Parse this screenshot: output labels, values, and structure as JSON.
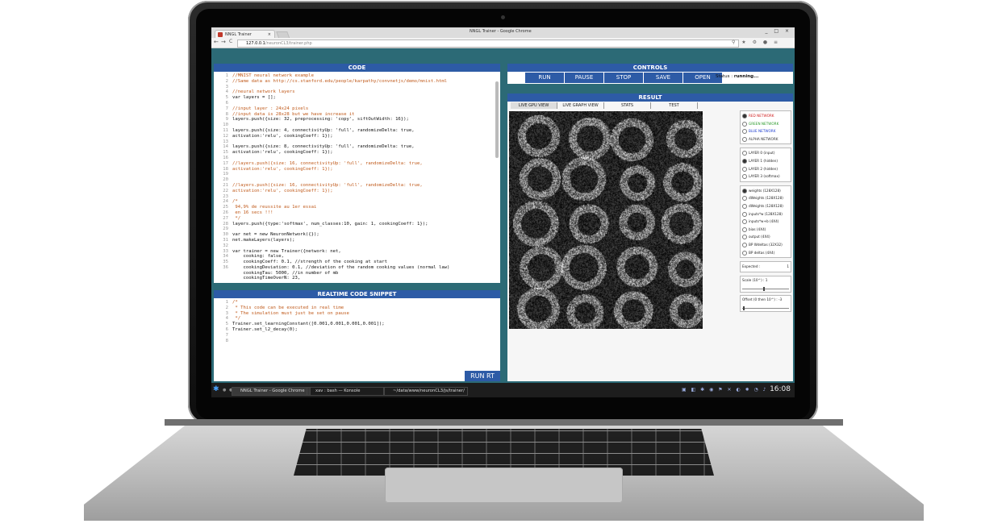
{
  "window": {
    "title": "NNGL Trainer - Google Chrome",
    "tab_title": "NNGL Trainer",
    "tab_close": "×",
    "buttons": "_ □ ×"
  },
  "browser": {
    "url_host": "127.0.0.1",
    "url_path": "/neuronCL3/trainer.php",
    "back": "←",
    "forward": "→",
    "reload": "C"
  },
  "code_panel": {
    "title": "CODE",
    "line_numbers": "1\n2\n3\n4\n5\n6\n7\n8\n9\n10\n11\n12\n13\n14\n15\n16\n17\n18\n19\n20\n21\n22\n23\n24\n25\n26\n27\n28\n29\n30\n31\n32\n33\n34\n35\n36",
    "lines": [
      {
        "t": "//MNIST neural network example",
        "c": "c-com"
      },
      {
        "t": "//Same data as http://cs.stanford.edu/people/karpathy/convnetjs/demo/mnist.html",
        "c": "c-com"
      },
      {
        "t": "",
        "c": ""
      },
      {
        "t": "//neural network layers",
        "c": "c-com"
      },
      {
        "t": "var layers = [];",
        "c": ""
      },
      {
        "t": "",
        "c": ""
      },
      {
        "t": "//input layer : 24x24 pixels",
        "c": "c-com"
      },
      {
        "t": "//input data is 28x28 but we have increase it",
        "c": "c-com"
      },
      {
        "t": "layers.push({size: 32, preprocessing: 'copy', siftOutWidth: 16});",
        "c": ""
      },
      {
        "t": "",
        "c": ""
      },
      {
        "t": "layers.push({size: 4, connectivityUp: 'full', randomizeDelta: true,",
        "c": ""
      },
      {
        "t": "activation:'relu', cookingCoeff: 1});",
        "c": ""
      },
      {
        "t": "",
        "c": ""
      },
      {
        "t": "layers.push({size: 8, connectivityUp: 'full', randomizeDelta: true,",
        "c": ""
      },
      {
        "t": "activation:'relu', cookingCoeff: 1});",
        "c": ""
      },
      {
        "t": "",
        "c": ""
      },
      {
        "t": "//layers.push({size: 16, connectivityUp: 'full', randomizeDelta: true,",
        "c": "c-com"
      },
      {
        "t": "activation:'relu', cookingCoeff: 1});",
        "c": "c-com"
      },
      {
        "t": "",
        "c": ""
      },
      {
        "t": "",
        "c": ""
      },
      {
        "t": "//layers.push({size: 16, connectivityUp: 'full', randomizeDelta: true,",
        "c": "c-com"
      },
      {
        "t": "activation:'relu', cookingCoeff: 1});",
        "c": "c-com"
      },
      {
        "t": "",
        "c": ""
      },
      {
        "t": "/*",
        "c": "c-com"
      },
      {
        "t": " 94,9% de reussite au 1er essai",
        "c": "c-com"
      },
      {
        "t": " en 16 secs !!!",
        "c": "c-com"
      },
      {
        "t": " */",
        "c": "c-com"
      },
      {
        "t": "layers.push({type:'softmax', num_classes:10, gain: 1, cookingCoeff: 1});",
        "c": ""
      },
      {
        "t": "",
        "c": ""
      },
      {
        "t": "var net = new NeuronNetwork({});",
        "c": ""
      },
      {
        "t": "net.makeLayers(layers);",
        "c": ""
      },
      {
        "t": "",
        "c": ""
      },
      {
        "t": "var trainer = new Trainer({network: net,",
        "c": ""
      },
      {
        "t": "    cooking: false,",
        "c": ""
      },
      {
        "t": "    cookingCoeff: 0.1, //strength of the cooking at start",
        "c": ""
      },
      {
        "t": "    cookingDeviation: 0.1, //deviation of the random cooking values (normal law)",
        "c": ""
      },
      {
        "t": "    cookingTau: 5000, //in number of mb",
        "c": ""
      },
      {
        "t": "    cookingTimeOverN: 23,",
        "c": ""
      }
    ]
  },
  "snippet_panel": {
    "title": "REALTIME CODE SNIPPET",
    "line_numbers": "1\n2\n3\n4\n5\n6\n7\n8",
    "lines": [
      {
        "t": "/*",
        "c": "c-com"
      },
      {
        "t": " * This code can be executed in real time",
        "c": "c-com"
      },
      {
        "t": " * The simulation must just be set on pause",
        "c": "c-com"
      },
      {
        "t": " */",
        "c": "c-com"
      },
      {
        "t": "Trainer.set_learningConstant([0.001,0.001,0.001,0.001]);",
        "c": ""
      },
      {
        "t": "Trainer.set_l2_decay(0);",
        "c": ""
      },
      {
        "t": "",
        "c": ""
      },
      {
        "t": "",
        "c": ""
      }
    ],
    "run_label": "RUN RT"
  },
  "controls": {
    "title": "CONTROLS",
    "buttons": [
      "RUN",
      "PAUSE",
      "STOP",
      "SAVE",
      "OPEN"
    ],
    "status_label": "Status :",
    "status_value": "running..."
  },
  "result": {
    "title": "RESULT",
    "tabs": [
      "LIVE GPU VIEW",
      "LIVE GRAPH VIEW",
      "STATS",
      "TEST"
    ],
    "networks": [
      {
        "label": "RED NETWORK",
        "color": "#d02020",
        "selected": true
      },
      {
        "label": "GREEN NETWORK",
        "color": "#2a9a2a",
        "selected": false
      },
      {
        "label": "BLUE NETWORK",
        "color": "#2040d0",
        "selected": false
      },
      {
        "label": "ALPHA NETWORK",
        "color": "#333333",
        "selected": false
      }
    ],
    "layers": [
      {
        "label": "LAYER 0 (input)",
        "selected": false
      },
      {
        "label": "LAYER 1 (hidden)",
        "selected": true
      },
      {
        "label": "LAYER 2 (hidden)",
        "selected": false
      },
      {
        "label": "LAYER 3 (softmax)",
        "selected": false
      }
    ],
    "views": [
      {
        "label": "weights (128X128)",
        "selected": true
      },
      {
        "label": "dWeights (128X128)",
        "selected": false
      },
      {
        "label": "dWeights (128X128)",
        "selected": false
      },
      {
        "label": "inputs*w (128X128)",
        "selected": false
      },
      {
        "label": "inputs*w+b (4X4)",
        "selected": false
      },
      {
        "label": "bias (4X4)",
        "selected": false
      },
      {
        "label": "output (4X4)",
        "selected": false
      },
      {
        "label": "BP Wdeltas (32X32)",
        "selected": false
      },
      {
        "label": "BP deltas (4X4)",
        "selected": false
      }
    ],
    "expected_label": "Expected :",
    "expected_value": "1",
    "scale_label": "Scale (10^) :",
    "scale_value": "1",
    "offset_label": "Offset (0 then 10^) :",
    "offset_value": "-3"
  },
  "taskbar": {
    "items": [
      "NNGL Trainer - Google Chrome",
      "xav : bash — Konsole",
      "~/data/www/neuronCL3/js/trainer/"
    ],
    "clock": "16:08"
  }
}
